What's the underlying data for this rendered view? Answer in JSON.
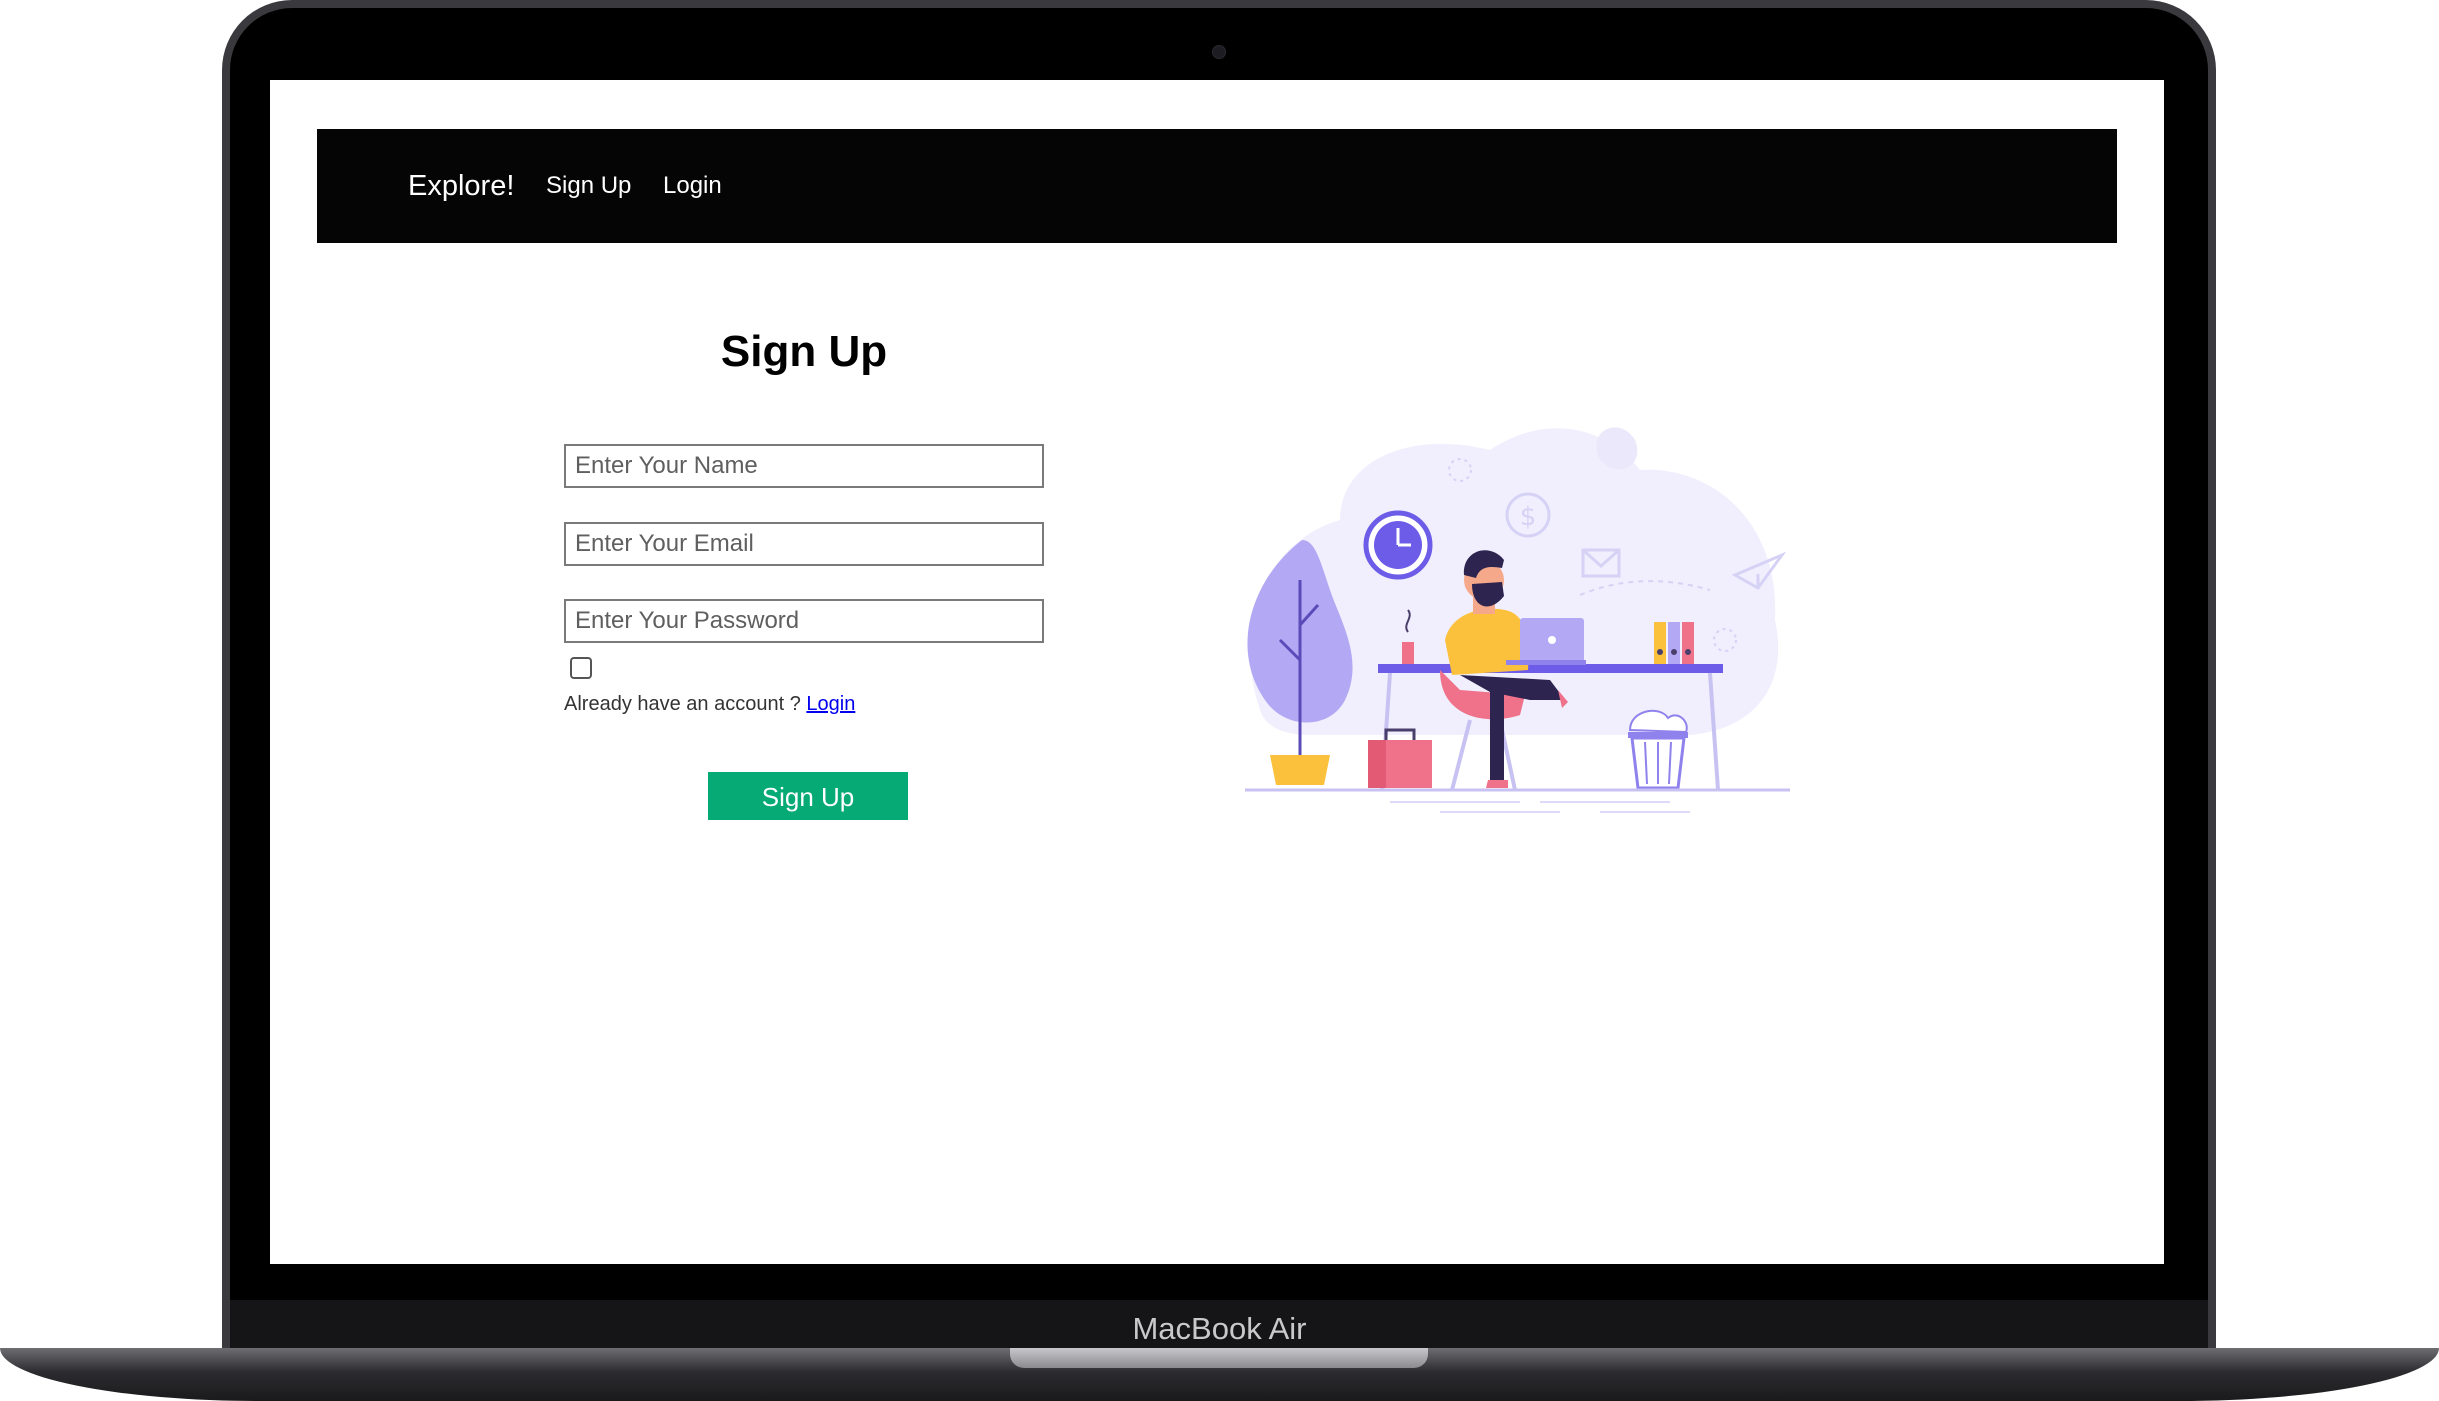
{
  "device": {
    "label": "MacBook Air"
  },
  "navbar": {
    "brand": "Explore!",
    "links": [
      {
        "label": "Sign Up"
      },
      {
        "label": "Login"
      }
    ]
  },
  "form": {
    "title": "Sign Up",
    "name_placeholder": "Enter Your Name",
    "email_placeholder": "Enter Your Email",
    "password_placeholder": "Enter Your Password",
    "checkbox_checked": false,
    "account_prompt": "Already have an account ?",
    "login_link": "Login",
    "submit_label": "Sign Up"
  },
  "colors": {
    "navbar_bg": "#050505",
    "submit_bg": "#05aa75",
    "link": "#0000ee",
    "illustration_purple": "#6c5ce7",
    "illustration_yellow": "#fcc13c",
    "illustration_pink": "#f0728a"
  }
}
